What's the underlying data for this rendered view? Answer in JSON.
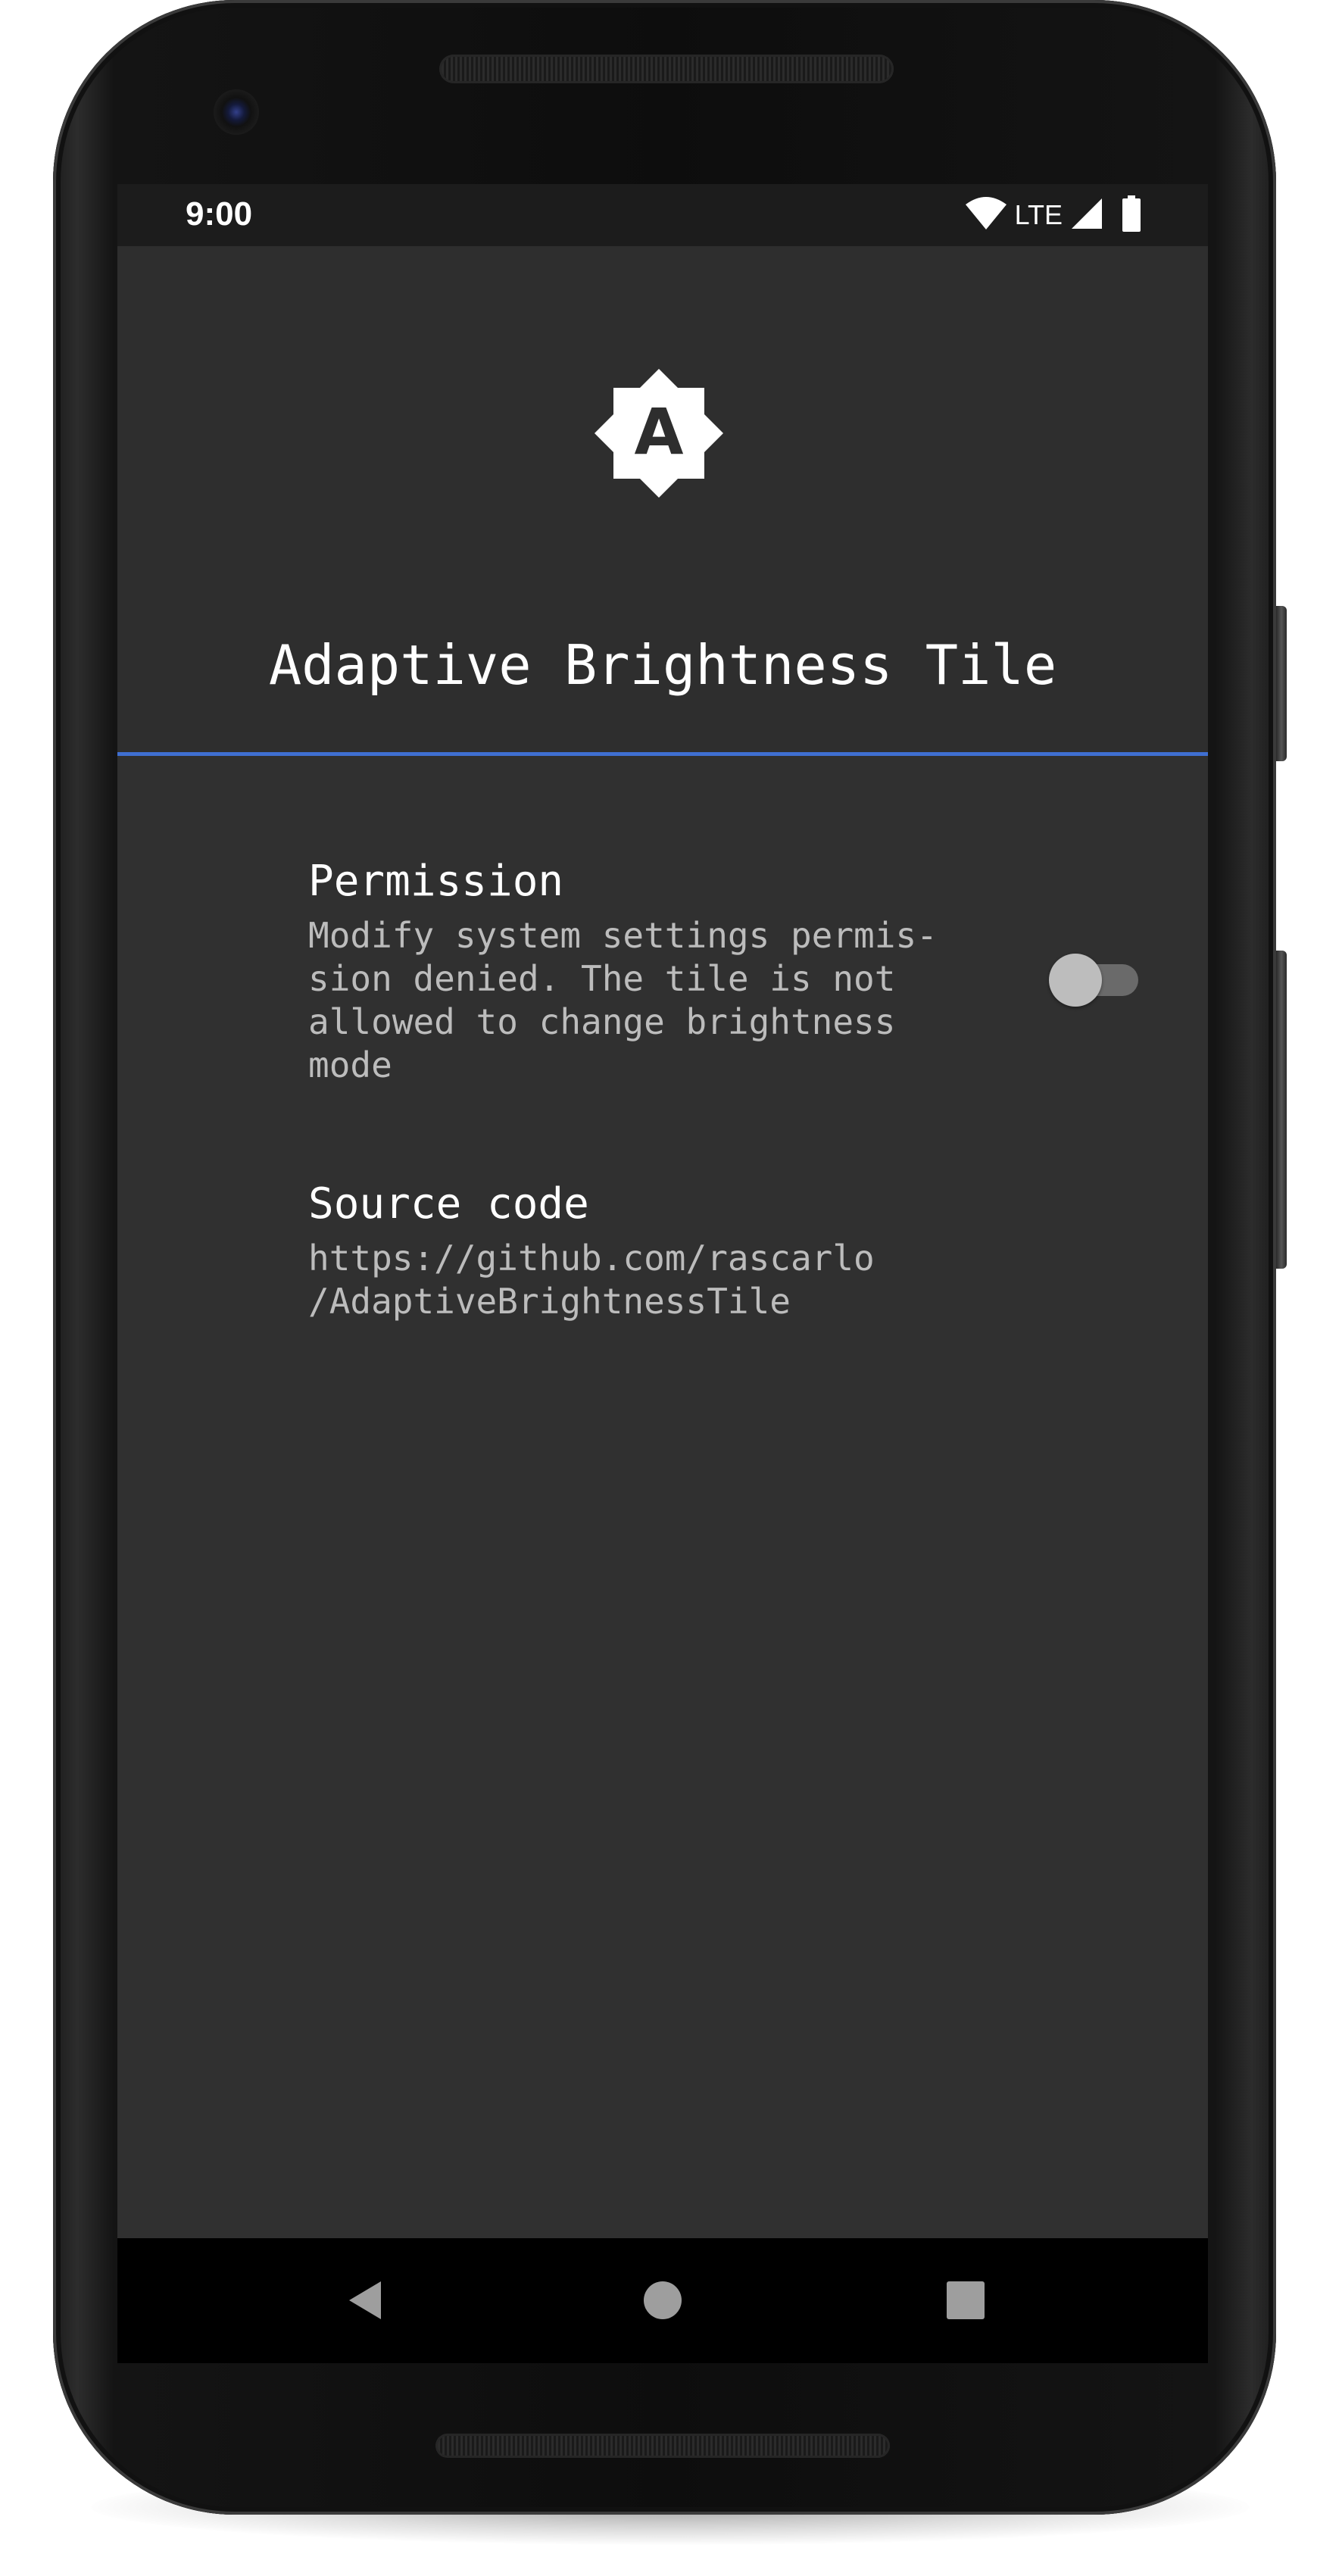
{
  "status_bar": {
    "time": "9:00",
    "network_label": "LTE",
    "icons": [
      "wifi-icon",
      "cellular-signal-icon",
      "battery-icon"
    ]
  },
  "app": {
    "logo_icon": "adaptive-brightness-icon",
    "logo_letter": "A",
    "title": "Adaptive Brightness Tile",
    "accent_color": "#3f6fd1",
    "background_color": "#303030"
  },
  "preferences": {
    "permission": {
      "title": "Permission",
      "summary": "Modify system settings permis-\nsion denied. The tile is not\nallowed to change brightness\nmode",
      "toggle_on": false
    },
    "source_code": {
      "title": "Source code",
      "summary": "https://github.com/rascarlo\n/AdaptiveBrightnessTile"
    }
  },
  "navigation": {
    "buttons": [
      "back-icon",
      "home-icon",
      "recents-icon"
    ]
  }
}
